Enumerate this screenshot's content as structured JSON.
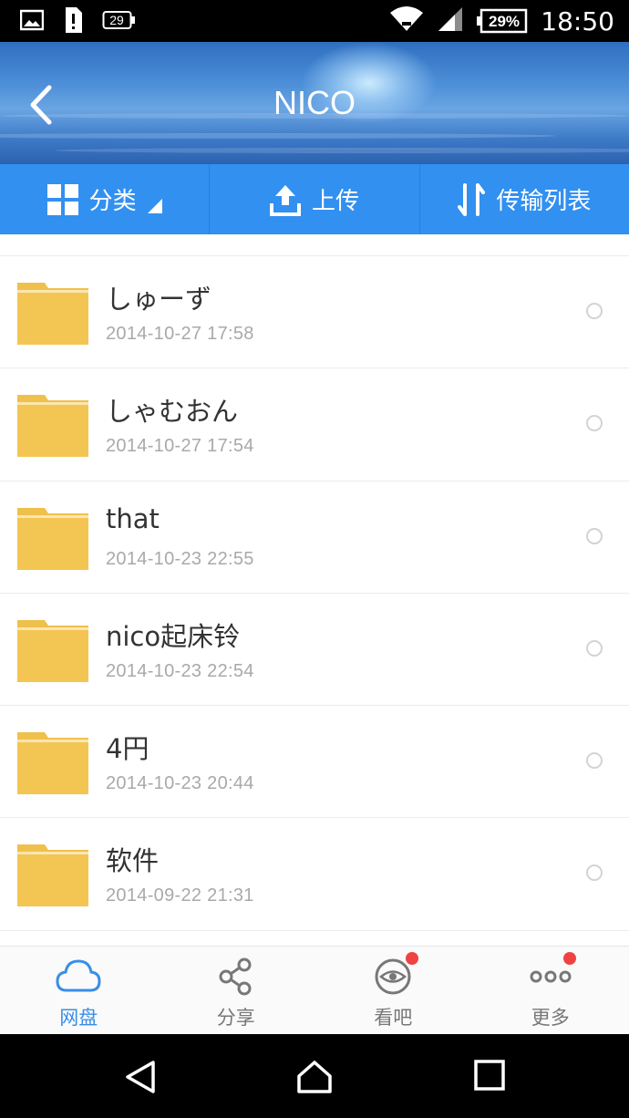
{
  "status_bar": {
    "left_icons": [
      "image-icon",
      "sim-alert-icon",
      "battery-saver-icon"
    ],
    "battery_saver_label": "29",
    "right_icons": [
      "wifi-icon",
      "signal-icon",
      "battery-icon"
    ],
    "battery_percent": "29%",
    "time": "18:50"
  },
  "header": {
    "title": "NICO",
    "back_icon": "chevron-left-icon"
  },
  "toolbar": {
    "items": [
      {
        "label": "分类",
        "icon": "grid-icon"
      },
      {
        "label": "上传",
        "icon": "upload-icon"
      },
      {
        "label": "传输列表",
        "icon": "transfer-icon"
      }
    ]
  },
  "files": [
    {
      "name": "しゅーず",
      "date": "2014-10-27  17:58"
    },
    {
      "name": "しゃむおん",
      "date": "2014-10-27  17:54"
    },
    {
      "name": "that",
      "date": "2014-10-23  22:55"
    },
    {
      "name": "nico起床铃",
      "date": "2014-10-23  22:54"
    },
    {
      "name": "4円",
      "date": "2014-10-23  20:44"
    },
    {
      "name": "软件",
      "date": "2014-09-22  21:31"
    }
  ],
  "tabbar": {
    "tabs": [
      {
        "label": "网盘",
        "icon": "cloud-icon",
        "active": true,
        "badge": false
      },
      {
        "label": "分享",
        "icon": "share-icon",
        "active": false,
        "badge": false
      },
      {
        "label": "看吧",
        "icon": "eye-icon",
        "active": false,
        "badge": true
      },
      {
        "label": "更多",
        "icon": "more-icon",
        "active": false,
        "badge": true
      }
    ]
  },
  "colors": {
    "accent": "#3290f0",
    "folder": "#f2c451",
    "badge": "#ef4343",
    "active_tab": "#3a8ee6"
  },
  "navbar": {
    "icons": [
      "back-triangle-icon",
      "home-icon",
      "recents-icon"
    ]
  }
}
